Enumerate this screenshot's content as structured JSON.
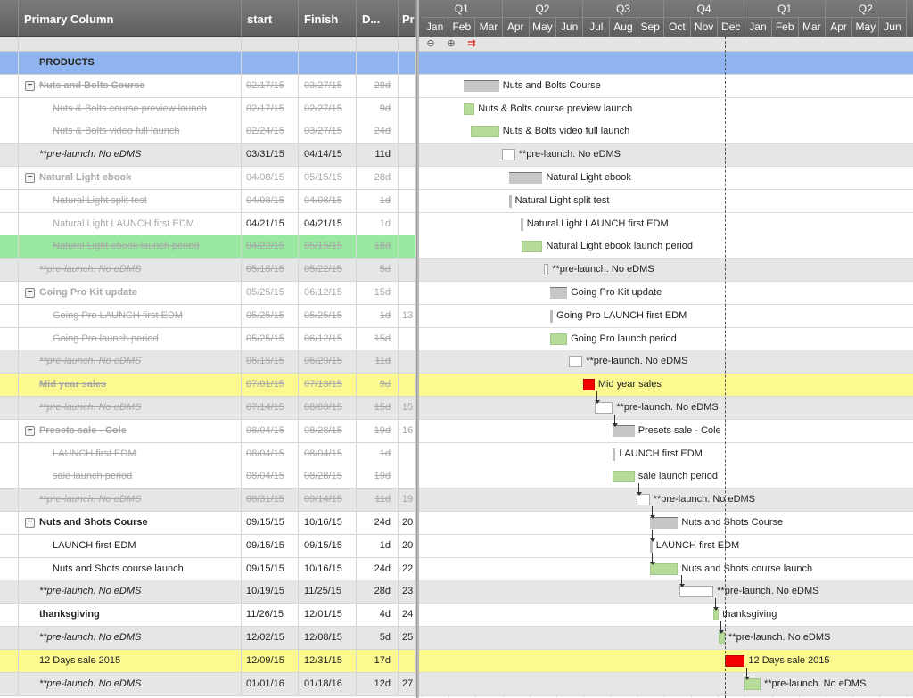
{
  "grid": {
    "headers": {
      "name": "Primary Column",
      "start": "start",
      "finish": "Finish",
      "duration": "D...",
      "predecessors": "Pr"
    },
    "rows": [
      {
        "name": "PRODUCTS",
        "start": "",
        "finish": "",
        "duration": "",
        "pred": ""
      },
      {
        "name": "Nuts and Bolts Course",
        "start": "02/17/15",
        "finish": "03/27/15",
        "duration": "29d",
        "pred": ""
      },
      {
        "name": "Nuts & Bolts course preview launch",
        "start": "02/17/15",
        "finish": "02/27/15",
        "duration": "9d",
        "pred": ""
      },
      {
        "name": "Nuts & Bolts video full launch",
        "start": "02/24/15",
        "finish": "03/27/15",
        "duration": "24d",
        "pred": ""
      },
      {
        "name": "**pre-launch. No eDMS",
        "start": "03/31/15",
        "finish": "04/14/15",
        "duration": "11d",
        "pred": ""
      },
      {
        "name": "Natural Light ebook",
        "start": "04/08/15",
        "finish": "05/15/15",
        "duration": "28d",
        "pred": ""
      },
      {
        "name": "Natural Light split test",
        "start": "04/08/15",
        "finish": "04/08/15",
        "duration": "1d",
        "pred": ""
      },
      {
        "name": "Natural Light LAUNCH first EDM",
        "start": "04/21/15",
        "finish": "04/21/15",
        "duration": "1d",
        "pred": ""
      },
      {
        "name": "Natural Light ebook launch period",
        "start": "04/22/15",
        "finish": "05/15/15",
        "duration": "18d",
        "pred": ""
      },
      {
        "name": "**pre-launch. No eDMS",
        "start": "05/18/15",
        "finish": "05/22/15",
        "duration": "5d",
        "pred": ""
      },
      {
        "name": "Going Pro Kit update",
        "start": "05/25/15",
        "finish": "06/12/15",
        "duration": "15d",
        "pred": ""
      },
      {
        "name": "Going Pro LAUNCH first EDM",
        "start": "05/25/15",
        "finish": "05/25/15",
        "duration": "1d",
        "pred": "13"
      },
      {
        "name": "Going Pro launch period",
        "start": "05/25/15",
        "finish": "06/12/15",
        "duration": "15d",
        "pred": ""
      },
      {
        "name": "**pre-launch. No eDMS",
        "start": "06/15/15",
        "finish": "06/29/15",
        "duration": "11d",
        "pred": ""
      },
      {
        "name": "Mid year sales",
        "start": "07/01/15",
        "finish": "07/13/15",
        "duration": "9d",
        "pred": ""
      },
      {
        "name": "**pre-launch. No eDMS",
        "start": "07/14/15",
        "finish": "08/03/15",
        "duration": "15d",
        "pred": "15"
      },
      {
        "name": "Presets sale - Cole",
        "start": "08/04/15",
        "finish": "08/28/15",
        "duration": "19d",
        "pred": "16"
      },
      {
        "name": "LAUNCH first EDM",
        "start": "08/04/15",
        "finish": "08/04/15",
        "duration": "1d",
        "pred": ""
      },
      {
        "name": "sale launch period",
        "start": "08/04/15",
        "finish": "08/28/15",
        "duration": "19d",
        "pred": ""
      },
      {
        "name": "**pre-launch. No eDMS",
        "start": "08/31/15",
        "finish": "09/14/15",
        "duration": "11d",
        "pred": "19"
      },
      {
        "name": "Nuts and Shots Course",
        "start": "09/15/15",
        "finish": "10/16/15",
        "duration": "24d",
        "pred": "20"
      },
      {
        "name": "LAUNCH first EDM",
        "start": "09/15/15",
        "finish": "09/15/15",
        "duration": "1d",
        "pred": "20"
      },
      {
        "name": "Nuts and Shots course launch",
        "start": "09/15/15",
        "finish": "10/16/15",
        "duration": "24d",
        "pred": "22"
      },
      {
        "name": "**pre-launch. No eDMS",
        "start": "10/19/15",
        "finish": "11/25/15",
        "duration": "28d",
        "pred": "23"
      },
      {
        "name": "thanksgiving",
        "start": "11/26/15",
        "finish": "12/01/15",
        "duration": "4d",
        "pred": "24"
      },
      {
        "name": "**pre-launch. No eDMS",
        "start": "12/02/15",
        "finish": "12/08/15",
        "duration": "5d",
        "pred": "25"
      },
      {
        "name": "12 Days sale 2015",
        "start": "12/09/15",
        "finish": "12/31/15",
        "duration": "17d",
        "pred": ""
      },
      {
        "name": "**pre-launch. No eDMS",
        "start": "01/01/16",
        "finish": "01/18/16",
        "duration": "12d",
        "pred": "27"
      }
    ]
  },
  "gantt": {
    "quarters": [
      "Q1",
      "Q2",
      "Q3",
      "Q4",
      "Q1",
      "Q2"
    ],
    "months": [
      "Jan",
      "Feb",
      "Mar",
      "Apr",
      "May",
      "Jun",
      "Jul",
      "Aug",
      "Sep",
      "Oct",
      "Nov",
      "Dec",
      "Jan",
      "Feb",
      "Mar",
      "Apr",
      "May",
      "Jun"
    ],
    "toolbar": {
      "zoom_out": "zoom-out",
      "zoom_in": "zoom-in",
      "critical_path": "critical-path"
    },
    "bar_labels": [
      "",
      "Nuts and Bolts Course",
      "Nuts & Bolts course preview launch",
      "Nuts & Bolts video full launch",
      "**pre-launch. No eDMS",
      "Natural Light ebook",
      "Natural Light split test",
      "Natural Light LAUNCH first EDM",
      "Natural Light ebook launch period",
      "**pre-launch. No eDMS",
      "Going Pro Kit update",
      "Going Pro LAUNCH first EDM",
      "Going Pro launch period",
      "**pre-launch. No eDMS",
      "Mid year sales",
      "**pre-launch. No eDMS",
      "Presets sale - Cole",
      "LAUNCH first EDM",
      "sale launch period",
      "**pre-launch. No eDMS",
      "Nuts and Shots Course",
      "LAUNCH first EDM",
      "Nuts and Shots course launch",
      "**pre-launch. No eDMS",
      "thanksgiving",
      "**pre-launch. No eDMS",
      "12 Days sale 2015",
      "**pre-launch. No eDMS"
    ]
  },
  "colors": {
    "blue_row": "#8fb4f0",
    "gray_row": "#e6e6e6",
    "yellow_row": "#fbf98f",
    "green_row": "#98e8a0",
    "red_bar": "#f40000",
    "green_bar": "#b7dc9a"
  }
}
